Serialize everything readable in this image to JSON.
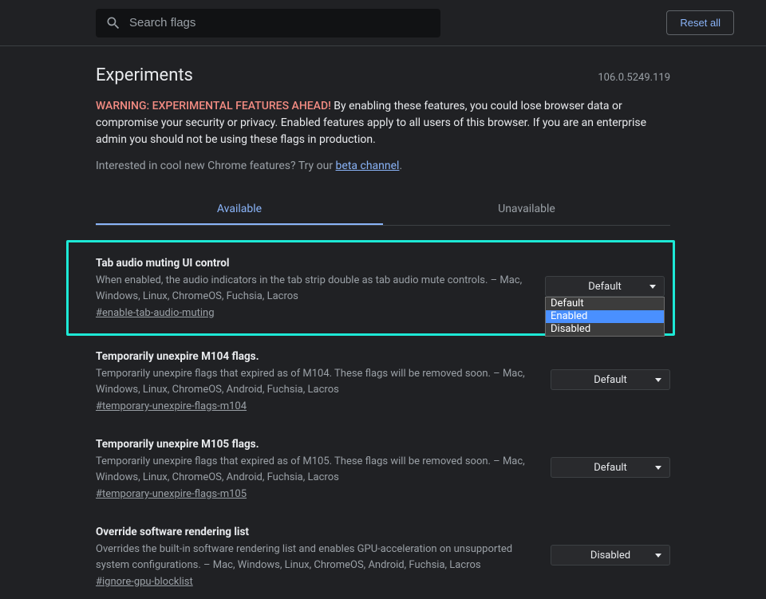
{
  "search": {
    "placeholder": "Search flags"
  },
  "reset_label": "Reset all",
  "page_title": "Experiments",
  "version": "106.0.5249.119",
  "warning_prefix": "WARNING: EXPERIMENTAL FEATURES AHEAD!",
  "warning_body": " By enabling these features, you could lose browser data or compromise your security or privacy. Enabled features apply to all users of this browser. If you are an enterprise admin you should not be using these flags in production.",
  "interest_prefix": "Interested in cool new Chrome features? Try our ",
  "beta_link_text": "beta channel",
  "interest_suffix": ".",
  "tabs": {
    "available": "Available",
    "unavailable": "Unavailable"
  },
  "dropdown_options": [
    "Default",
    "Enabled",
    "Disabled"
  ],
  "flags": [
    {
      "title": "Tab audio muting UI control",
      "desc": "When enabled, the audio indicators in the tab strip double as tab audio mute controls. – Mac, Windows, Linux, ChromeOS, Fuchsia, Lacros",
      "anchor": "#enable-tab-audio-muting",
      "value": "Default",
      "highlight": true,
      "dropdown_open": true,
      "dropdown_hover_index": 1
    },
    {
      "title": "Temporarily unexpire M104 flags.",
      "desc": "Temporarily unexpire flags that expired as of M104. These flags will be removed soon. – Mac, Windows, Linux, ChromeOS, Android, Fuchsia, Lacros",
      "anchor": "#temporary-unexpire-flags-m104",
      "value": "Default"
    },
    {
      "title": "Temporarily unexpire M105 flags.",
      "desc": "Temporarily unexpire flags that expired as of M105. These flags will be removed soon. – Mac, Windows, Linux, ChromeOS, Android, Fuchsia, Lacros",
      "anchor": "#temporary-unexpire-flags-m105",
      "value": "Default"
    },
    {
      "title": "Override software rendering list",
      "desc": "Overrides the built-in software rendering list and enables GPU-acceleration on unsupported system configurations. – Mac, Windows, Linux, ChromeOS, Android, Fuchsia, Lacros",
      "anchor": "#ignore-gpu-blocklist",
      "value": "Disabled"
    }
  ]
}
